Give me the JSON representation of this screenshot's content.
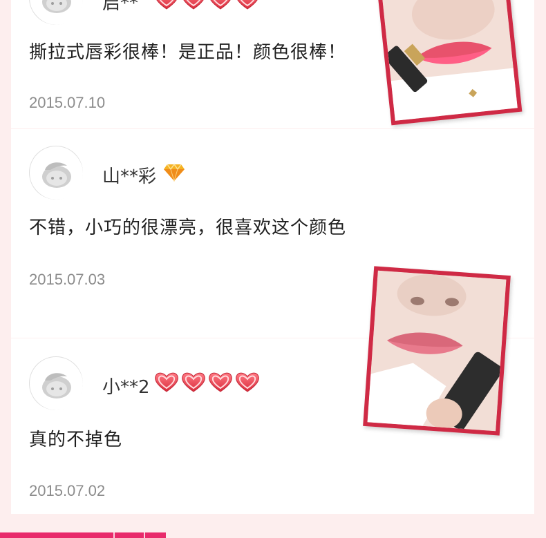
{
  "reviews": [
    {
      "username": "启**",
      "hearts": 4,
      "comment": "撕拉式唇彩很棒！是正品！颜色很棒！",
      "date": "2015.07.10",
      "has_photo": true
    },
    {
      "username": "山**彩",
      "badge": "diamond-icon",
      "comment": "不错，小巧的很漂亮，很喜欢这个颜色",
      "date": "2015.07.03",
      "has_photo": true
    },
    {
      "username": "小**2",
      "hearts": 4,
      "comment": "真的不掉色",
      "date": "2015.07.02"
    }
  ],
  "colors": {
    "accent": "#e82a6b",
    "heart": "#e8424f",
    "photo_frame": "#cf2a45",
    "page_background": "#fdeeee",
    "badge_gold": "#f5b323"
  }
}
